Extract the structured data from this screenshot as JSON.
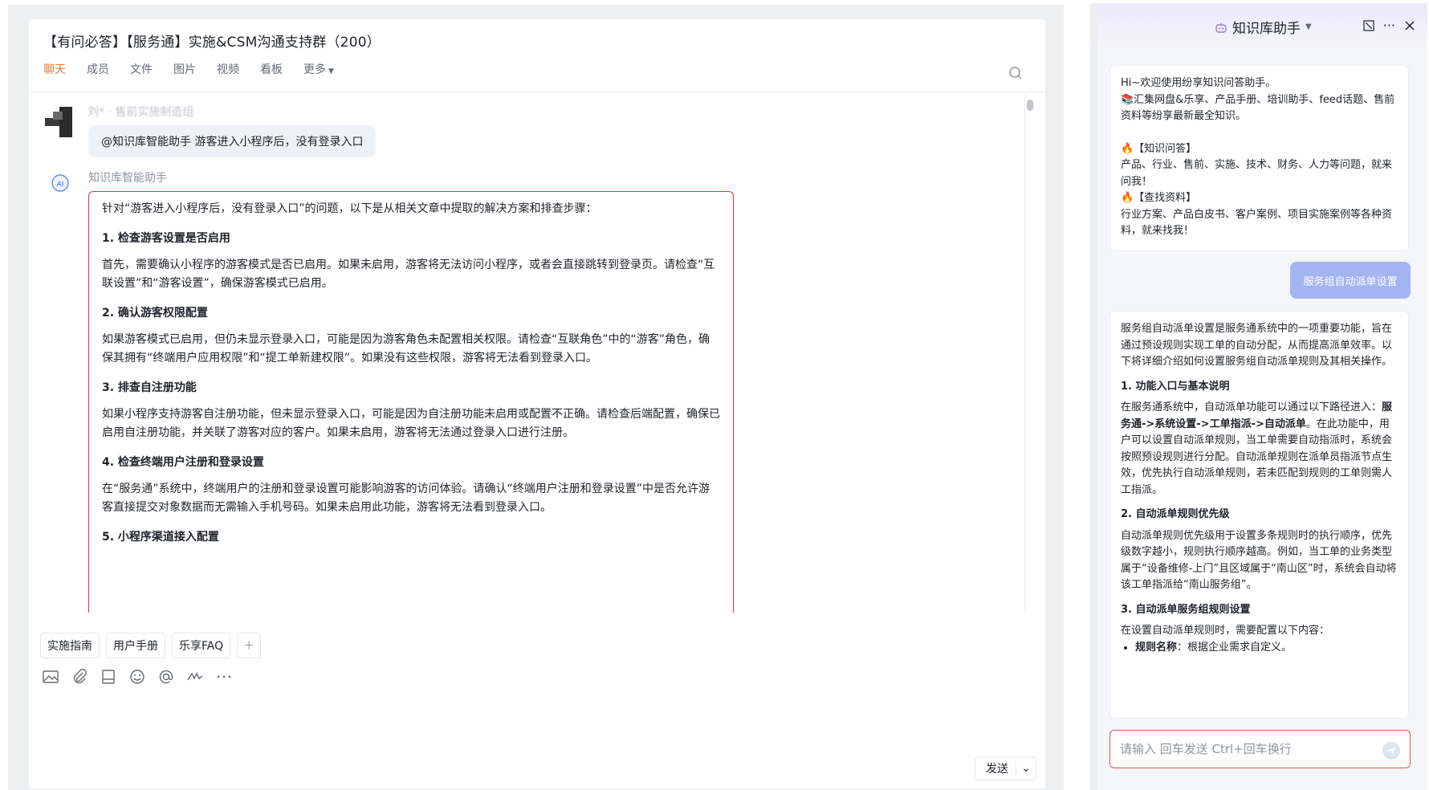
{
  "chat": {
    "title": "【有问必答】【服务通】实施&CSM沟通支持群（200）",
    "tabs": [
      {
        "label": "聊天"
      },
      {
        "label": "成员"
      },
      {
        "label": "文件"
      },
      {
        "label": "图片"
      },
      {
        "label": "视频"
      },
      {
        "label": "看板"
      },
      {
        "label": "更多"
      }
    ],
    "messages": {
      "user": {
        "sender": "刘* · 售前实施制造组",
        "text": "@知识库智能助手 游客进入小程序后，没有登录入口"
      },
      "bot": {
        "sender": "知识库智能助手",
        "intro": "针对“游客进入小程序后，没有登录入口”的问题，以下是从相关文章中提取的解决方案和排查步骤：",
        "steps": [
          {
            "title": "1. 检查游客设置是否启用",
            "body": "首先，需要确认小程序的游客模式是否已启用。如果未启用，游客将无法访问小程序，或者会直接跳转到登录页。请检查“互联设置”和“游客设置”，确保游客模式已启用。"
          },
          {
            "title": "2. 确认游客权限配置",
            "body": "如果游客模式已启用，但仍未显示登录入口，可能是因为游客角色未配置相关权限。请检查“互联角色”中的“游客”角色，确保其拥有“终端用户应用权限”和“提工单新建权限”。如果没有这些权限，游客将无法看到登录入口。"
          },
          {
            "title": "3. 排查自注册功能",
            "body": "如果小程序支持游客自注册功能，但未显示登录入口，可能是因为自注册功能未启用或配置不正确。请检查后端配置，确保已启用自注册功能，并关联了游客对应的客户。如果未启用，游客将无法通过登录入口进行注册。"
          },
          {
            "title": "4. 检查终端用户注册和登录设置",
            "body": "在“服务通”系统中，终端用户的注册和登录设置可能影响游客的访问体验。请确认“终端用户注册和登录设置”中是否允许游客直接提交对象数据而无需输入手机号码。如果未启用此功能，游客将无法看到登录入口。"
          },
          {
            "title": "5. 小程序渠道接入配置",
            "body": ""
          }
        ]
      }
    },
    "chips": [
      "实施指南",
      "用户手册",
      "乐享FAQ"
    ],
    "send_label": "发送"
  },
  "assistant": {
    "title": "知识库助手",
    "welcome": {
      "line1": "Hi~欢迎使用纷享知识问答助手。",
      "line2": "📚汇集网盘&乐享、产品手册、培训助手、feed话题、售前资料等纷享最新最全知识。",
      "qa_title": "🔥【知识问答】",
      "qa_body": "产品、行业、售前、实施、技术、财务、人力等问题，就来问我！",
      "find_title": "🔥【查找资料】",
      "find_body": "行业方案、产品白皮书、客户案例、项目实施案例等各种资料，就来找我！"
    },
    "user_question": "服务组自动派单设置",
    "answer": {
      "intro": "服务组自动派单设置是服务通系统中的一项重要功能，旨在通过预设规则实现工单的自动分配，从而提高派单效率。以下将详细介绍如何设置服务组自动派单规则及其相关操作。",
      "s1_title": "1. 功能入口与基本说明",
      "s1_pre": "在服务通系统中，自动派单功能可以通过以下路径进入：",
      "s1_path": "服务通->系统设置->工单指派->自动派单",
      "s1_post": "。在此功能中，用户可以设置自动派单规则，当工单需要自动指派时，系统会按照预设规则进行分配。自动派单规则在派单员指派节点生效，优先执行自动派单规则，若未匹配到规则的工单则需人工指派。",
      "s2_title": "2. 自动派单规则优先级",
      "s2_body": "自动派单规则优先级用于设置多条规则时的执行顺序，优先级数字越小，规则执行顺序越高。例如，当工单的业务类型属于“设备维修-上门”且区域属于“南山区”时，系统会自动将该工单指派给“南山服务组”。",
      "s3_title": "3. 自动派单服务组规则设置",
      "s3_body": "在设置自动派单规则时，需要配置以下内容：",
      "s3_item_label": "规则名称",
      "s3_item_text": "：根据企业需求自定义。"
    },
    "input_placeholder": "请输入 回车发送 Ctrl+回车换行"
  }
}
